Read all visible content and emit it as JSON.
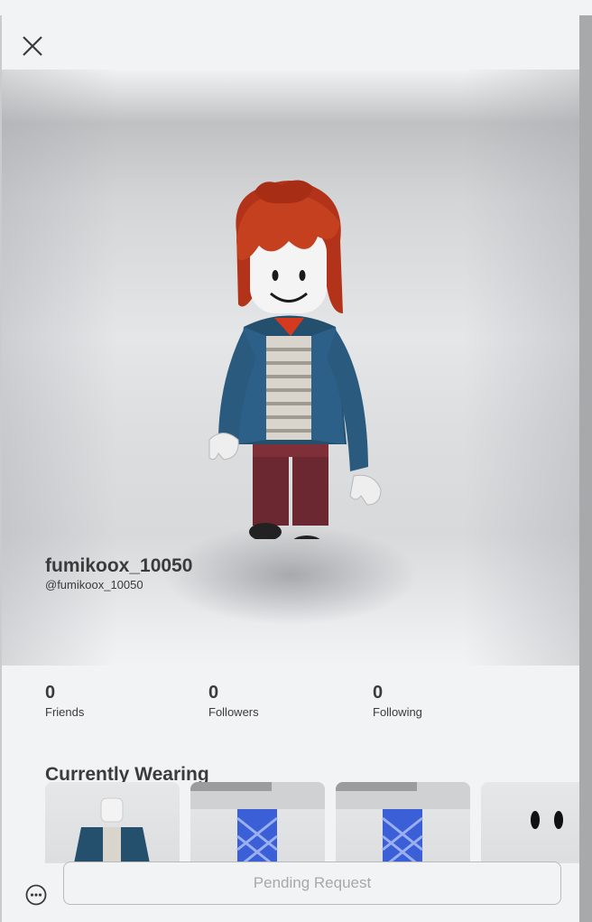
{
  "profile": {
    "display_name": "fumikoox_10050",
    "username": "@fumikoox_10050"
  },
  "stats": [
    {
      "count": "0",
      "label": "Friends"
    },
    {
      "count": "0",
      "label": "Followers"
    },
    {
      "count": "0",
      "label": "Following"
    }
  ],
  "currently_wearing": {
    "title": "Currently Wearing",
    "items": [
      "jacket-shirt",
      "pants-left",
      "pants-right",
      "face"
    ]
  },
  "actions": {
    "pending_label": "Pending Request",
    "more_icon": "more-options-icon",
    "close_icon": "close-icon"
  },
  "colors": {
    "text": "#393b3d",
    "background": "#f2f3f4",
    "disabled_text": "#a6a8aa"
  }
}
